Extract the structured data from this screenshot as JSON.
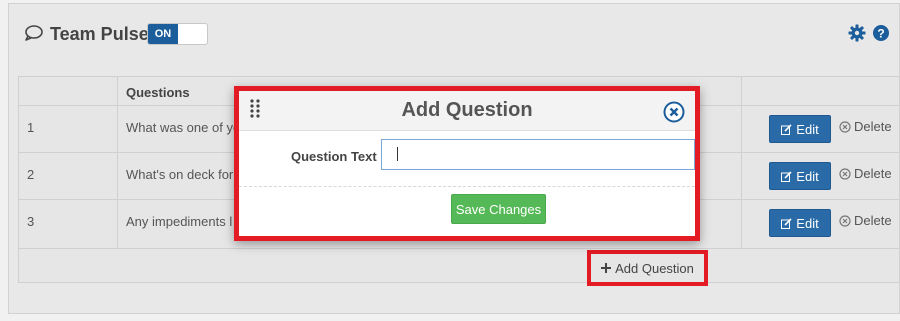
{
  "header": {
    "title": "Team Pulse",
    "toggle_label": "ON",
    "toggle_state": "on",
    "icons": [
      "chat-icon",
      "gear-icon",
      "help-icon"
    ]
  },
  "table": {
    "column_header": "Questions",
    "rows": [
      {
        "num": "1",
        "question": "What was one of yo"
      },
      {
        "num": "2",
        "question": "What's on deck for"
      },
      {
        "num": "3",
        "question": "Any impediments l"
      }
    ],
    "edit_label": "Edit",
    "delete_label": "Delete",
    "add_label": "Add Question"
  },
  "modal": {
    "title": "Add Question",
    "field_label": "Question Text",
    "field_value": "",
    "save_label": "Save Changes"
  },
  "colors": {
    "accent_blue": "#2a6aa6",
    "toggle_blue": "#1c5d9c",
    "save_green": "#56b957",
    "highlight_red": "#e21b24"
  }
}
